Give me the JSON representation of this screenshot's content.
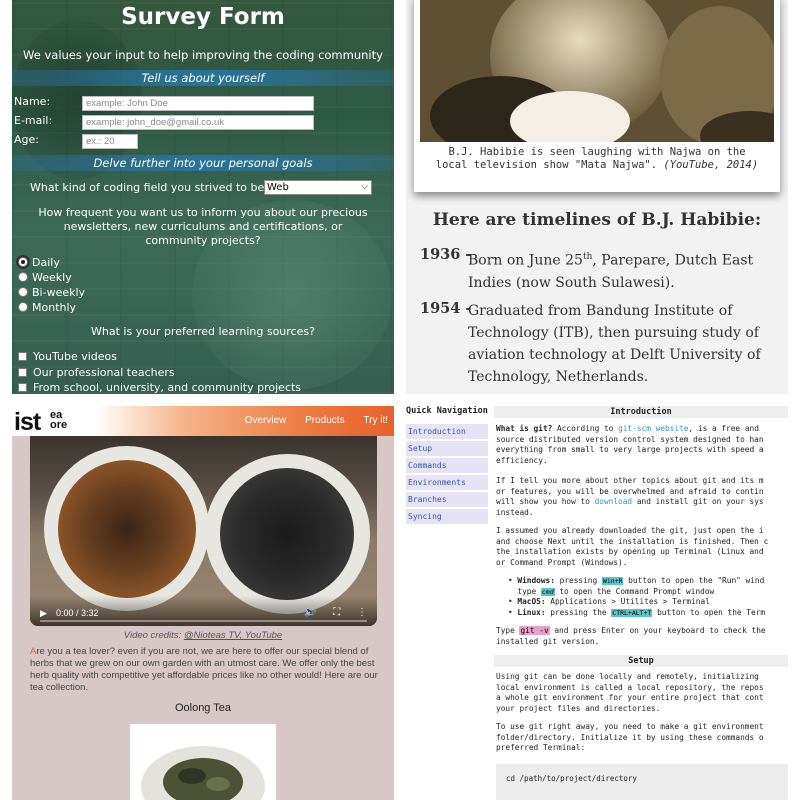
{
  "survey": {
    "title": "Survey Form",
    "subtitle": "We values your input to help improving the coding community",
    "section1": "Tell us about yourself",
    "name_label": "Name:",
    "name_placeholder": "example: John Doe",
    "email_label": "E-mail:",
    "email_placeholder": "example: john_doe@gmail.co.uk",
    "age_label": "Age:",
    "age_placeholder": "ex.: 20",
    "section2": "Delve further into your personal goals",
    "coding_field_question": "What kind of coding field you strived to be?",
    "coding_field_value": "Web",
    "frequency_question": "How frequent you want us to inform you about our precious newsletters, new curriculums and certifications, or community projects?",
    "frequency_options": [
      "Daily",
      "Weekly",
      "Bi-weekly",
      "Monthly"
    ],
    "frequency_selected": "Daily",
    "sources_question": "What is your preferred learning sources?",
    "sources_options": [
      "YouTube videos",
      "Our professional teachers",
      "From school, university, and community projects"
    ]
  },
  "habibie": {
    "caption_line1": "B.J. Habibie is seen laughing with Najwa on the",
    "caption_line2": "local television show \"Mata Najwa\".",
    "caption_source": "(YouTube, 2014)",
    "heading": "Here are timelines of B.J. Habibie:",
    "timeline": [
      {
        "year": "1936 -",
        "text_a": "Born on June 25",
        "sup": "th",
        "text_b": ", Parepare, Dutch East Indies (now South Sulawesi)."
      },
      {
        "year": "1954 -",
        "text": "Graduated from Bandung Institute of Technology (ITB), then pursuing study of aviation technology at Delft University of Technology, Netherlands."
      }
    ]
  },
  "tea": {
    "logo_main": "ist",
    "logo_top": "ea",
    "logo_bottom": "ore",
    "nav": [
      "Overview",
      "Products",
      "Try it!"
    ],
    "video_time": "0:00 / 3:32",
    "credit_prefix": "Video credits: ",
    "credit_link": "@Nioteas TV, YouTube",
    "intro_first": "A",
    "intro_rest": "re you a tea lover? even if you are not, we are here to offer our special blend of herbs that we grew on our own garden with an utmost care. We offer only the best herb quality with competitive yet affordable prices like no other would! Here are our tea collection.",
    "product_title": "Oolong Tea"
  },
  "git": {
    "quick_nav": "Quick Navigation",
    "nav_items": [
      "Introduction",
      "Setup",
      "Commands",
      "Environments",
      "Branches",
      "Syncing"
    ],
    "intro_heading": "Introduction",
    "setup_heading": "Setup",
    "intro_p1_bold": "What is git?",
    "intro_p1_a": " According to ",
    "intro_p1_link": "git-scm website",
    "intro_p1_b": ", is a free and",
    "intro_p1_lines": [
      "source distributed version control system designed to han",
      "everything from small to very large projects with speed a",
      "efficiency."
    ],
    "intro_p2_lines": [
      "If I tell you more about other topics about git and its m",
      "or features, you will be overwhelmed and afraid to contin"
    ],
    "intro_p2_c_a": "will show you how to ",
    "intro_p2_link": "download",
    "intro_p2_c_b": " and install git on your sys",
    "intro_p2_d": "instead.",
    "intro_p3_lines": [
      "I assumed you already downloaded the git, just open the i",
      "and choose Next until the installation is finished. Then c",
      "the installation exists by opening up Terminal (Linux and",
      "or Command Prompt (Windows)."
    ],
    "win_label": "Windows:",
    "win_a": " pressing ",
    "win_key": "Win+R",
    "win_b": " button to open the \"Run\" wind",
    "win_c_a": "type ",
    "win_cmd": "cmd",
    "win_c_b": " to open the Command Prompt window",
    "mac_label": "MacOS:",
    "mac_text": " Applications > Utilites > Terminal",
    "linux_label": "Linux:",
    "linux_a": " pressing the ",
    "linux_key": "CTRL+ALT+T",
    "linux_b": " button to open the Term",
    "type_a": "Type ",
    "type_cmd": "git -v",
    "type_b": " and press Enter on your keyboard to check the",
    "type_c": "installed git version.",
    "setup_lines": [
      "Using git can be done locally and remotely, initializing",
      "local environment is called a local repository, the repos",
      "a whole git environment for your entire project that cont",
      "your project files and directories."
    ],
    "setup2_lines": [
      "To use git right away, you need to make a git environment",
      "folder/directory. Initialize it by using these commands o",
      "preferred Terminal:"
    ],
    "code_line": "cd /path/to/project/directory"
  }
}
